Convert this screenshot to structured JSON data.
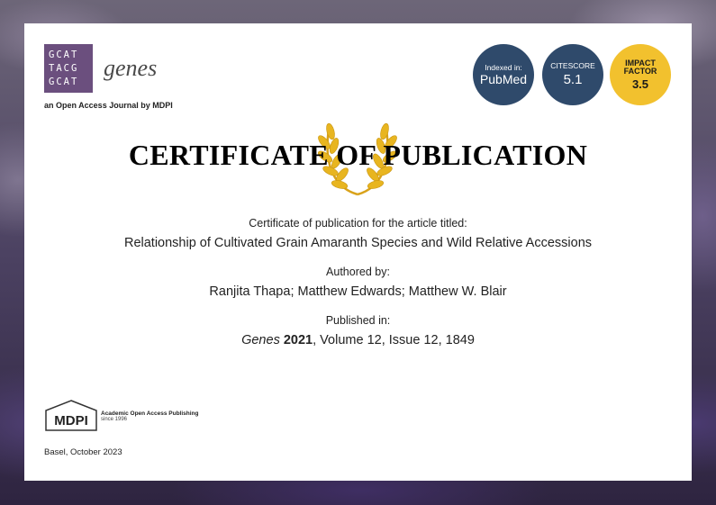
{
  "journal": {
    "logo_lines": [
      "GCAT",
      "TACG",
      "GCAT"
    ],
    "name": "genes",
    "tagline": "an Open Access Journal by MDPI"
  },
  "badges": {
    "pubmed": {
      "label": "Indexed in:",
      "value": "PubMed"
    },
    "citescore": {
      "label": "CITESCORE",
      "value": "5.1"
    },
    "impact_factor": {
      "label_line1": "IMPACT",
      "label_line2": "FACTOR",
      "value": "3.5"
    }
  },
  "certificate": {
    "title": "CERTIFICATE OF PUBLICATION",
    "article_label": "Certificate of publication for the article titled:",
    "article_title": "Relationship of Cultivated Grain Amaranth Species and Wild Relative Accessions",
    "authors_label": "Authored by:",
    "authors": "Ranjita Thapa; Matthew Edwards; Matthew W. Blair",
    "published_label": "Published in:",
    "journal_italic": "Genes",
    "year": "2021",
    "volume_issue": ", Volume 12, Issue 12, 1849"
  },
  "publisher": {
    "logo": "MDPI",
    "line1": "Academic Open Access Publishing",
    "line2": "since 1996"
  },
  "place_date": "Basel, October 2023",
  "colors": {
    "gcat_bg": "#6b4f7e",
    "badge_blue": "#2f4a6b",
    "badge_yellow": "#f2c12e",
    "laurel_gold": "#e8b520"
  }
}
